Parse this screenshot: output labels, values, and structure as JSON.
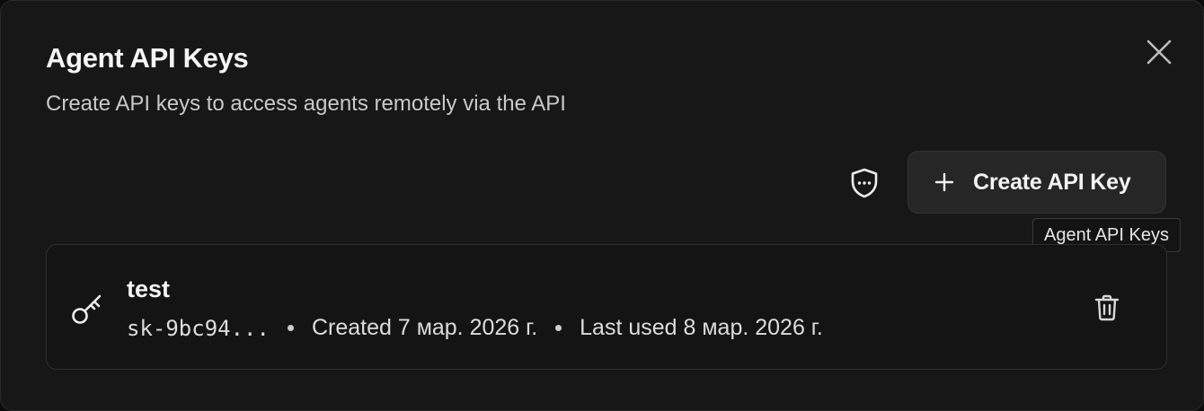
{
  "dialog": {
    "title": "Agent API Keys",
    "subtitle": "Create API keys to access agents remotely via the API",
    "close_icon": "close-icon"
  },
  "toolbar": {
    "security_icon": "shield-icon",
    "create_label": "Create API Key",
    "create_icon": "plus-icon",
    "tooltip": "Agent API Keys"
  },
  "keys": [
    {
      "name": "test",
      "prefix": "sk-9bc94...",
      "created": "Created 7 мар. 2026 г.",
      "last_used": "Last used 8 мар. 2026 г.",
      "delete_icon": "trash-icon"
    }
  ],
  "colors": {
    "background": "#171717",
    "card_border": "#2e2e2e",
    "button_bg": "#262626",
    "text_primary": "#f5f5f5",
    "text_secondary": "#c9c9c9"
  }
}
